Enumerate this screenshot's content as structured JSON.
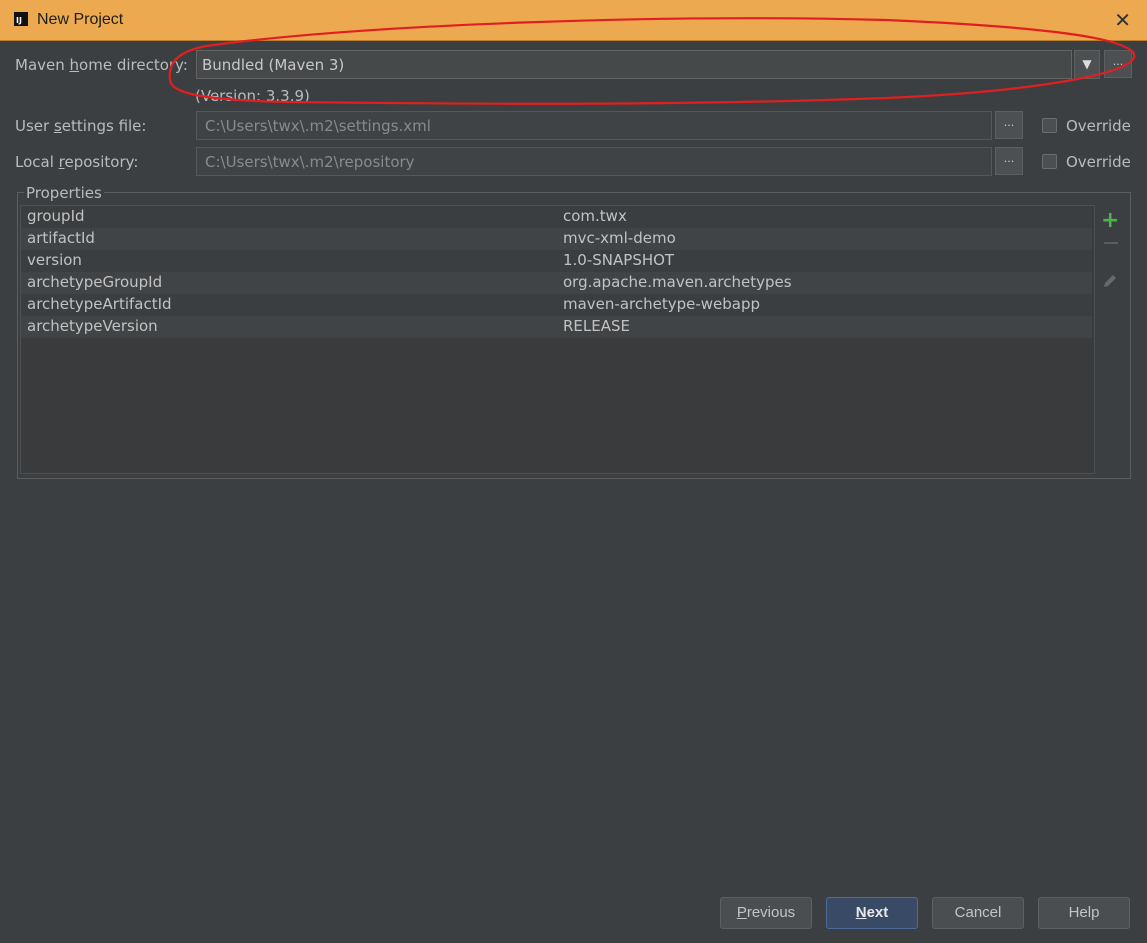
{
  "window": {
    "title": "New Project",
    "app_icon_text": "IJ",
    "close_glyph": "✕"
  },
  "maven": {
    "home_label_pre": "Maven ",
    "home_label_mnemonic": "h",
    "home_label_post": "ome directory:",
    "home_value": "Bundled (Maven 3)",
    "version_text": "(Version: 3.3.9)",
    "dropdown_glyph": "▼",
    "browse_glyph": "..."
  },
  "settings": {
    "label_pre": "User ",
    "label_mnemonic": "s",
    "label_post": "ettings file:",
    "value": "C:\\Users\\twx\\.m2\\settings.xml",
    "override_label": "Override",
    "browse_glyph": "..."
  },
  "repository": {
    "label_pre": "Local ",
    "label_mnemonic": "r",
    "label_post": "epository:",
    "value": "C:\\Users\\twx\\.m2\\repository",
    "override_label": "Override",
    "browse_glyph": "..."
  },
  "properties": {
    "title": "Properties",
    "rows": [
      {
        "key": "groupId",
        "value": "com.twx"
      },
      {
        "key": "artifactId",
        "value": "mvc-xml-demo"
      },
      {
        "key": "version",
        "value": "1.0-SNAPSHOT"
      },
      {
        "key": "archetypeGroupId",
        "value": "org.apache.maven.archetypes"
      },
      {
        "key": "archetypeArtifactId",
        "value": "maven-archetype-webapp"
      },
      {
        "key": "archetypeVersion",
        "value": "RELEASE"
      }
    ],
    "add_glyph": "+",
    "icons": {
      "add": "plus-icon",
      "remove": "minus-icon",
      "edit": "pencil-icon"
    }
  },
  "buttons": {
    "previous_mnemonic": "P",
    "previous_rest": "revious",
    "next_mnemonic": "N",
    "next_rest": "ext",
    "cancel": "Cancel",
    "help": "Help"
  },
  "colors": {
    "titlebar": "#eca94f",
    "background": "#3c3f41",
    "annotation": "#e02020",
    "add_icon": "#4bb34b",
    "primary_button": "#384a66"
  }
}
